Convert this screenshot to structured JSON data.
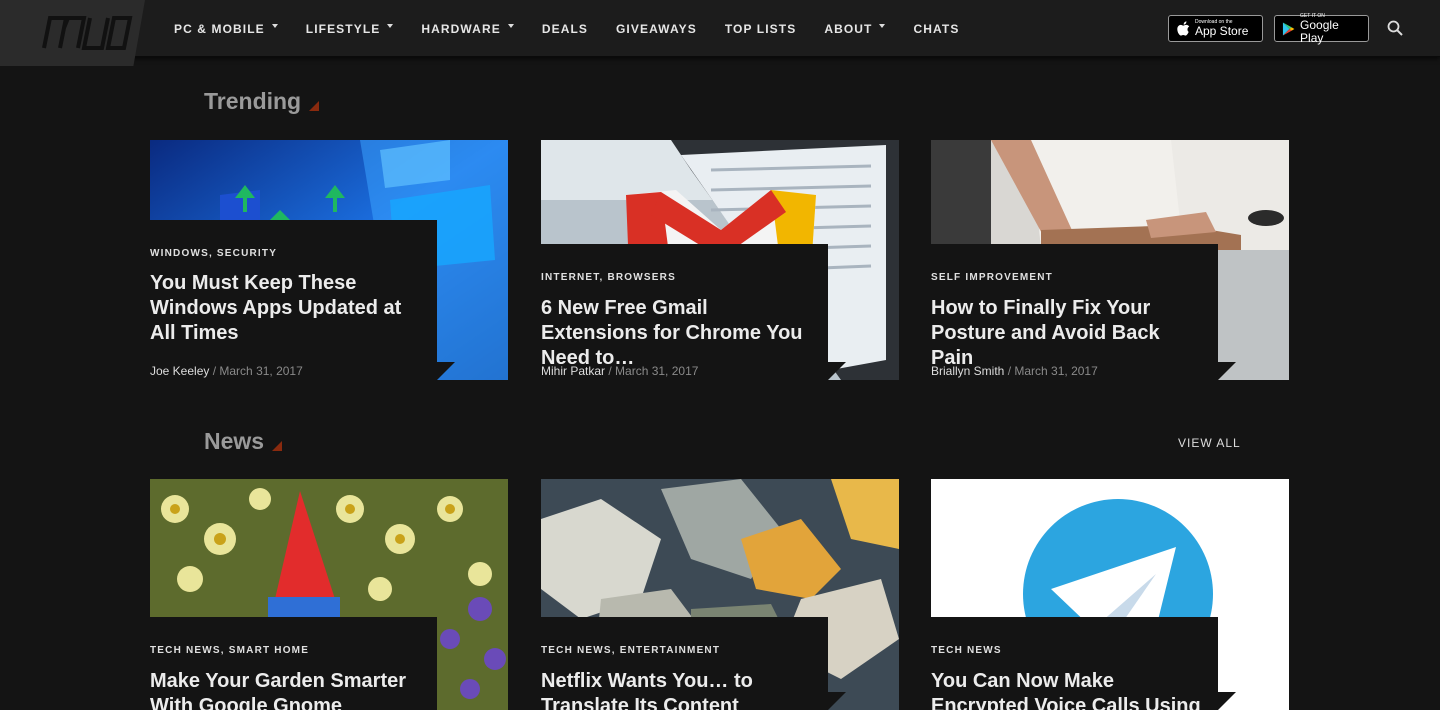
{
  "nav": {
    "items": [
      {
        "label": "PC & MOBILE",
        "dropdown": true
      },
      {
        "label": "LIFESTYLE",
        "dropdown": true
      },
      {
        "label": "HARDWARE",
        "dropdown": true
      },
      {
        "label": "DEALS",
        "dropdown": false
      },
      {
        "label": "GIVEAWAYS",
        "dropdown": false
      },
      {
        "label": "TOP LISTS",
        "dropdown": false
      },
      {
        "label": "ABOUT",
        "dropdown": true
      },
      {
        "label": "CHATS",
        "dropdown": false
      }
    ],
    "appstore": {
      "small": "Download on the",
      "big": "App Store"
    },
    "playstore": {
      "small": "GET IT ON",
      "big": "Google Play"
    }
  },
  "trending": {
    "title": "Trending",
    "cards": [
      {
        "cats": "WINDOWS, SECURITY",
        "title": "You Must Keep These Windows Apps Updated at All Times",
        "author": "Joe Keeley",
        "date": "March 31, 2017"
      },
      {
        "cats": "INTERNET, BROWSERS",
        "title": "6 New Free Gmail Extensions for Chrome You Need to…",
        "author": "Mihir Patkar",
        "date": "March 31, 2017"
      },
      {
        "cats": "SELF IMPROVEMENT",
        "title": "How to Finally Fix Your Posture and Avoid Back Pain",
        "author": "Briallyn Smith",
        "date": "March 31, 2017"
      }
    ]
  },
  "news": {
    "title": "News",
    "view_all": "VIEW ALL",
    "cards": [
      {
        "cats": "TECH NEWS, SMART HOME",
        "title": "Make Your Garden Smarter With Google Gnome"
      },
      {
        "cats": "TECH NEWS, ENTERTAINMENT",
        "title": "Netflix Wants You… to Translate Its Content"
      },
      {
        "cats": "TECH NEWS",
        "title": "You Can Now Make Encrypted Voice Calls Using Telegram"
      }
    ]
  },
  "colors": {
    "accent": "#8a2a0e",
    "background": "#141414",
    "header": "#1c1c1c"
  }
}
